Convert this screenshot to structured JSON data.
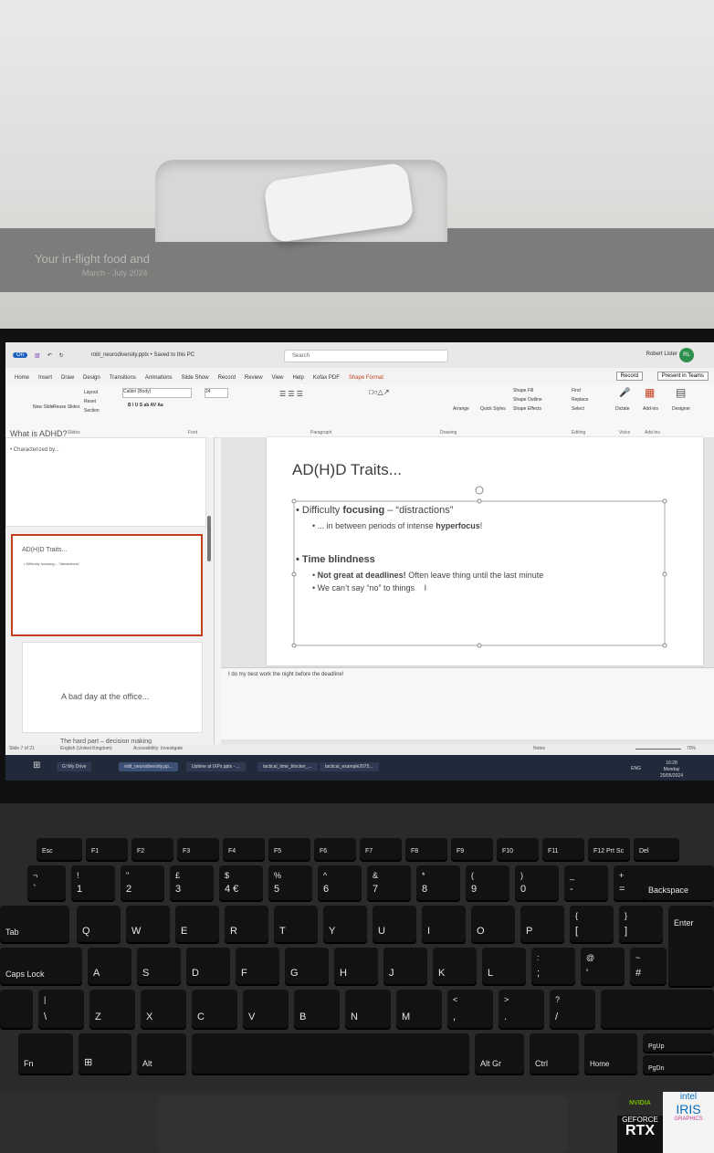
{
  "scene": {
    "tray_text": "Your in-flight food and",
    "tray_subtext": "March - July 2024"
  },
  "titlebar": {
    "autosave": "On",
    "filename": "robl_neurodiversity.pptx • Saved to this PC",
    "search_placeholder": "Search",
    "user_name": "Robert Lister",
    "user_initials": "RL"
  },
  "menubar": {
    "tabs": [
      "Home",
      "Insert",
      "Draw",
      "Design",
      "Transitions",
      "Animations",
      "Slide Show",
      "Record",
      "Review",
      "View",
      "Help",
      "Kofax PDF",
      "Shape Format"
    ],
    "active_tab": "Shape Format",
    "record_label": "Record",
    "present_label": "Present in Teams"
  },
  "ribbon": {
    "groups": [
      "Slides",
      "Font",
      "Paragraph",
      "Drawing",
      "Editing",
      "Voice",
      "Add-ins"
    ],
    "new_slide": "New Slide",
    "reuse_slides": "Reuse Slides",
    "layout": "Layout",
    "reset": "Reset",
    "section": "Section",
    "font_name": "Calibri (Body)",
    "font_size": "24",
    "shape_fill": "Shape Fill",
    "shape_outline": "Shape Outline",
    "shape_effects": "Shape Effects",
    "arrange": "Arrange",
    "quick_styles": "Quick Styles",
    "find": "Find",
    "replace": "Replace",
    "select": "Select",
    "dictate": "Dictate",
    "addins": "Add-ins",
    "designer": "Designer"
  },
  "thumbnails": [
    {
      "title": "What is ADHD?",
      "body": "• Characterized by..."
    },
    {
      "title": "AD(H)D Traits...",
      "body": "• Difficulty focusing – \"distractions\""
    },
    {
      "title": "A bad day at the office...",
      "body": ""
    },
    {
      "title": "The hard part – decision making",
      "body": ""
    }
  ],
  "slide": {
    "title": "AD(H)D Traits...",
    "bullet1_plain": "Difficulty ",
    "bullet1_bold": "focusing",
    "bullet1_rest": " – “distractions”",
    "sub1_plain": "... in between periods of intense ",
    "sub1_bold": "hyperfocus",
    "sub1_end": "!",
    "bullet2": "Time blindness",
    "sub2_bold": "Not great at deadlines!",
    "sub2_rest": " Often leave thing until the last minute",
    "sub3": "We can’t say “no” to things"
  },
  "notes": "I do my best work the night before the deadline!",
  "statusbar": {
    "slide_count": "Slide 7 of 21",
    "language": "English (United Kingdom)",
    "accessibility": "Accessibility: Investigate",
    "notes": "Notes",
    "zoom": "70%"
  },
  "taskbar": {
    "items": [
      "G:\\My Drive",
      "robl_neurodiversity.pp...",
      "Uptime at IXPs.pptx - ...",
      "tactical_time_blocker_...",
      "tactical_example2075..."
    ],
    "lang": "ENG",
    "time": "16:28",
    "day": "Monday",
    "date": "20/05/2024"
  },
  "keyboard": {
    "row_fn": [
      "Esc",
      "F1",
      "F2",
      "F3",
      "F4",
      "F5",
      "F6",
      "F7",
      "F8",
      "F9",
      "F10",
      "F11",
      "F12 Prt Sc",
      "Del"
    ],
    "row_num": [
      [
        "¬",
        "`"
      ],
      [
        "!",
        "1"
      ],
      [
        "\"",
        "2"
      ],
      [
        "£",
        "3"
      ],
      [
        "$",
        "4 €"
      ],
      [
        "%",
        "5"
      ],
      [
        "^",
        "6"
      ],
      [
        "&",
        "7"
      ],
      [
        "*",
        "8"
      ],
      [
        "(",
        "9"
      ],
      [
        ")",
        "0"
      ],
      [
        "_",
        "-"
      ],
      [
        "+",
        "="
      ]
    ],
    "backspace": "Backspace",
    "tab": "Tab",
    "row_q": [
      "Q",
      "W",
      "E",
      "R",
      "T",
      "Y",
      "U",
      "I",
      "O",
      "P"
    ],
    "row_q_extra": [
      [
        "{",
        "["
      ],
      [
        "}",
        "]"
      ]
    ],
    "enter": "Enter",
    "caps": "Caps Lock",
    "row_a": [
      "A",
      "S",
      "D",
      "F",
      "G",
      "H",
      "J",
      "K",
      "L"
    ],
    "row_a_extra": [
      [
        ":",
        ";"
      ],
      [
        "@",
        "'"
      ],
      [
        "~",
        "#"
      ]
    ],
    "row_z_first": [
      "|",
      "\\"
    ],
    "row_z": [
      "Z",
      "X",
      "C",
      "V",
      "B",
      "N",
      "M"
    ],
    "row_z_extra": [
      [
        "<",
        ","
      ],
      [
        ">",
        "."
      ],
      [
        "?",
        "/"
      ]
    ],
    "fn": "Fn",
    "alt": "Alt",
    "altgr": "Alt Gr",
    "ctrl": "Ctrl",
    "home": "Home",
    "pgup": "PgUp",
    "pgdn": "PgDn"
  },
  "stickers": {
    "nvidia": "NVIDIA",
    "geforce": "GEFORCE",
    "rtx": "RTX",
    "intel": "intel",
    "iris": "IRIS",
    "graphics": "GRAPHICS"
  }
}
